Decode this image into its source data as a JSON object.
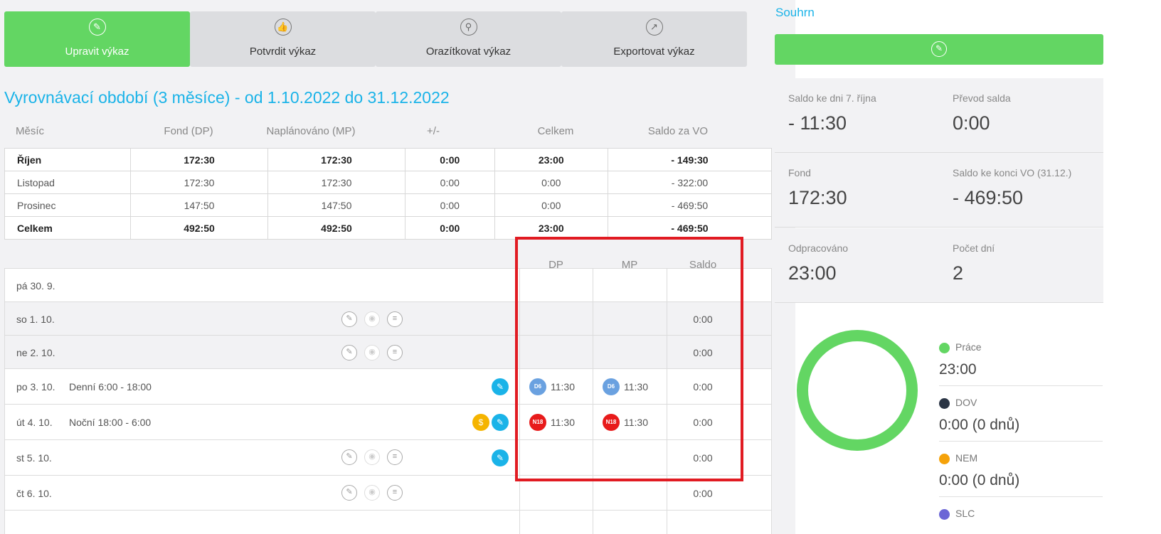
{
  "actions": [
    {
      "label": "Upravit výkaz",
      "icon": "pencil-icon"
    },
    {
      "label": "Potvrdit výkaz",
      "icon": "thumbs-up-icon"
    },
    {
      "label": "Orazítkovat výkaz",
      "icon": "stamp-icon"
    },
    {
      "label": "Exportovat výkaz",
      "icon": "export-icon"
    }
  ],
  "period_title": "Vyrovnávací období (3 měsíce) - od 1.10.2022 do 31.12.2022",
  "months_table": {
    "headers": [
      "Měsíc",
      "Fond (DP)",
      "Naplánováno (MP)",
      "+/-",
      "Celkem",
      "Saldo za VO"
    ],
    "rows": [
      {
        "name": "Říjen",
        "fond": "172:30",
        "planned": "172:30",
        "diff": "0:00",
        "total": "23:00",
        "saldo": "- 149:30"
      },
      {
        "name": "Listopad",
        "fond": "172:30",
        "planned": "172:30",
        "diff": "0:00",
        "total": "0:00",
        "saldo": "- 322:00"
      },
      {
        "name": "Prosinec",
        "fond": "147:50",
        "planned": "147:50",
        "diff": "0:00",
        "total": "0:00",
        "saldo": "- 469:50"
      },
      {
        "name": "Celkem",
        "fond": "492:50",
        "planned": "492:50",
        "diff": "0:00",
        "total": "23:00",
        "saldo": "- 469:50"
      }
    ]
  },
  "days_table": {
    "headers": [
      "DP",
      "MP",
      "Saldo"
    ],
    "rows": [
      {
        "date": "pá 30. 9.",
        "shift": "",
        "dp": "",
        "mp": "",
        "saldo": ""
      },
      {
        "date": "so 1. 10.",
        "shift": "",
        "dp": "",
        "mp": "",
        "saldo": "0:00"
      },
      {
        "date": "ne 2. 10.",
        "shift": "",
        "dp": "",
        "mp": "",
        "saldo": "0:00"
      },
      {
        "date": "po 3. 10.",
        "shift": "Denní 6:00 - 18:00",
        "dp_badge": "D6",
        "dp": "11:30",
        "mp_badge": "D6",
        "mp": "11:30",
        "saldo": "0:00"
      },
      {
        "date": "út 4. 10.",
        "shift": "Noční 18:00 - 6:00",
        "dp_badge": "N18",
        "dp": "11:30",
        "mp_badge": "N18",
        "mp": "11:30",
        "saldo": "0:00"
      },
      {
        "date": "st 5. 10.",
        "shift": "",
        "dp": "",
        "mp": "",
        "saldo": "0:00"
      },
      {
        "date": "čt 6. 10.",
        "shift": "",
        "dp": "",
        "mp": "",
        "saldo": "0:00"
      }
    ]
  },
  "summary": {
    "title": "Souhrn",
    "stats": [
      {
        "label": "Saldo ke dni 7. října",
        "value": "- 11:30"
      },
      {
        "label": "Převod salda",
        "value": "0:00"
      },
      {
        "label": "Fond",
        "value": "172:30"
      },
      {
        "label": "Saldo ke konci VO (31.12.)",
        "value": "- 469:50"
      },
      {
        "label": "Odpracováno",
        "value": "23:00"
      },
      {
        "label": "Počet dní",
        "value": "2"
      }
    ],
    "legend": [
      {
        "label": "Práce",
        "value": "23:00",
        "color": "#63d663"
      },
      {
        "label": "DOV",
        "value": "0:00 (0 dnů)",
        "color": "#2b3545"
      },
      {
        "label": "NEM",
        "value": "0:00 (0 dnů)",
        "color": "#f5a20a"
      },
      {
        "label": "SLC",
        "value": "",
        "color": "#6b66d6"
      }
    ]
  },
  "colors": {
    "primary": "#63d663",
    "accent": "#1ab3e8",
    "highlight": "#e11b22"
  }
}
